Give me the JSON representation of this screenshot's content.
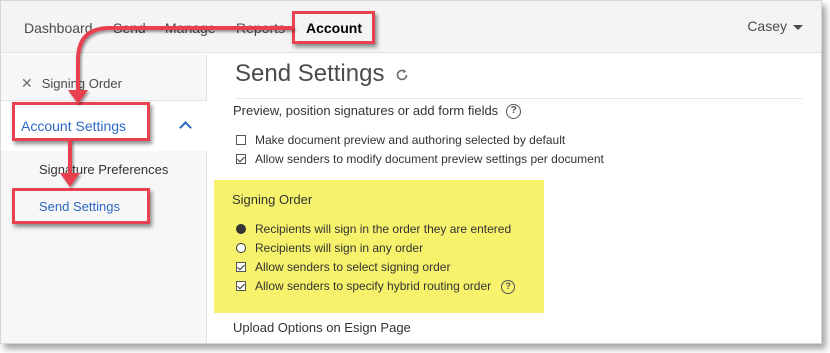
{
  "nav": {
    "items": [
      "Dashboard",
      "Send",
      "Manage",
      "Reports",
      "Account"
    ],
    "user": "Casey"
  },
  "sidebar": {
    "breadcrumb": "Signing Order",
    "section": "Account Settings",
    "subitems": [
      "Signature Preferences",
      "Send Settings"
    ]
  },
  "main": {
    "title": "Send Settings",
    "preview_heading": "Preview, position signatures or add form fields",
    "preview_options": [
      {
        "label": "Make document preview and authoring selected by default",
        "checked": false
      },
      {
        "label": "Allow senders to modify document preview settings per document",
        "checked": true
      }
    ],
    "signing_order": {
      "title": "Signing Order",
      "options": [
        {
          "label": "Recipients will sign in the order they are entered",
          "type": "radio",
          "selected": true
        },
        {
          "label": "Recipients will sign in any order",
          "type": "radio",
          "selected": false
        },
        {
          "label": "Allow senders to select signing order",
          "type": "checkbox",
          "checked": true
        },
        {
          "label": "Allow senders to specify hybrid routing order",
          "type": "checkbox",
          "checked": true
        }
      ]
    },
    "upload_heading": "Upload Options on Esign Page"
  },
  "colors": {
    "accent": "#2c69c7",
    "callout": "#e8414f",
    "highlight": "#f6f26b"
  }
}
